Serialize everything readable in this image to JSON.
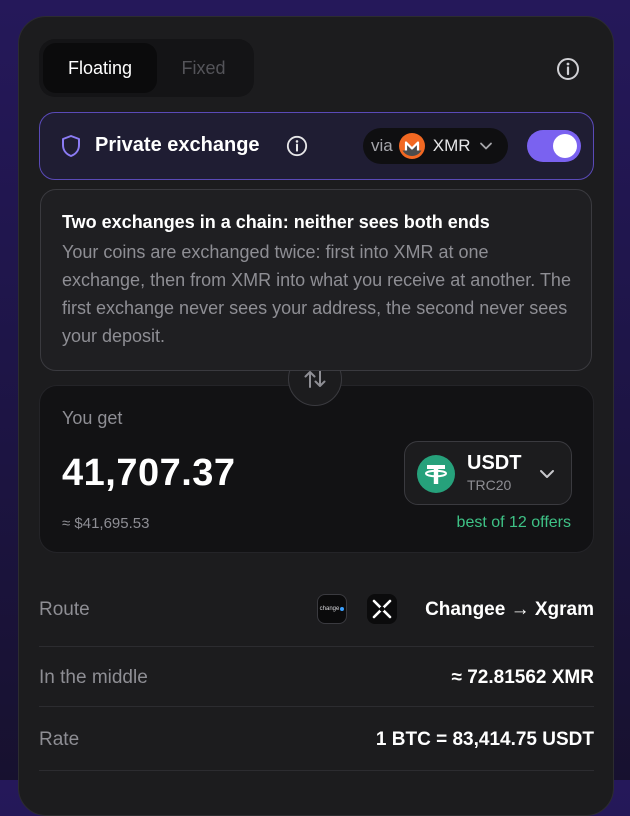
{
  "mode_switch": {
    "floating_label": "Floating",
    "fixed_label": "Fixed",
    "active": "Floating"
  },
  "private_exchange": {
    "label": "Private exchange",
    "via_label": "via",
    "via_coin": "XMR",
    "enabled": true
  },
  "tooltip": {
    "title": "Two exchanges in a chain: neither sees both ends",
    "body": "Your coins are exchanged twice: first into XMR at one exchange, then from XMR into what you receive at another. The first exchange never sees your address, the second never sees your deposit."
  },
  "you_get": {
    "label": "You get",
    "amount": "41,707.37",
    "usd_value": "≈ $41,695.53",
    "token": "USDT",
    "network": "TRC20",
    "offers_note": "best of 12 offers"
  },
  "details": {
    "route": {
      "label": "Route",
      "changee_logo_text": "change",
      "value": "Changee → Xgram"
    },
    "middle": {
      "label": "In the middle",
      "value": "≈ 72.81562 XMR"
    },
    "rate": {
      "label": "Rate",
      "value": "1 BTC = 83,414.75 USDT"
    }
  },
  "colors": {
    "accent": "#7a62f0",
    "success": "#3ec286",
    "monero_orange": "#f26822",
    "tether_green": "#26a17b"
  },
  "icons": {
    "info": "info-icon",
    "shield": "shield-icon",
    "swap": "swap-arrows-icon",
    "chevron": "chevron-down-icon"
  }
}
